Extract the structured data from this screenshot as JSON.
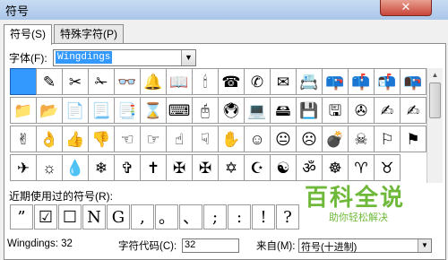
{
  "window": {
    "title": "符号",
    "close_label": "✕"
  },
  "tabs": [
    {
      "label": "符号(S)"
    },
    {
      "label": "特殊字符(P)"
    }
  ],
  "font": {
    "label": "字体(F):",
    "value": "Wingdings",
    "arrow": "▼"
  },
  "symbols": [
    "",
    "✎",
    "✂",
    "✁",
    "👓",
    "🔔",
    "📖",
    "🕯",
    "☎",
    "✆",
    "✉",
    "📇",
    "📪",
    "📫",
    "📬",
    "📭",
    "📁",
    "📂",
    "📄",
    "📃",
    "📑",
    "⌛",
    "⌨",
    "🖰",
    "🖲",
    "💻",
    "🖴",
    "💾",
    "🖫",
    "✇",
    "✍",
    "✍",
    "✌",
    "👌",
    "👍",
    "👎",
    "☜",
    "☞",
    "☝",
    "☟",
    "✋",
    "☺",
    "😐",
    "☹",
    "💣",
    "☠",
    "⚐",
    "⚑",
    "✈",
    "☼",
    "💧",
    "❄",
    "✞",
    "✝",
    "✠",
    "✠",
    "✡",
    "☪",
    "☯",
    "ॐ",
    "☸",
    "♈",
    "♉"
  ],
  "scrollbar": {
    "up_arrow": "▲"
  },
  "recent": {
    "label": "近期使用过的符号(R):",
    "items": [
      "”",
      "☑",
      "☐",
      "N",
      "G",
      ",",
      "。",
      "、",
      ";",
      ":",
      "!",
      "?"
    ]
  },
  "bottom": {
    "unicode_name": "Wingdings: 32",
    "code_label": "字符代码(C):",
    "code_value": "32",
    "from_label": "来自(M):",
    "from_value": "符号(十进制)",
    "from_arrow": "▼"
  },
  "watermark": {
    "title": "百科全说",
    "subtitle": "助你轻松解决"
  }
}
